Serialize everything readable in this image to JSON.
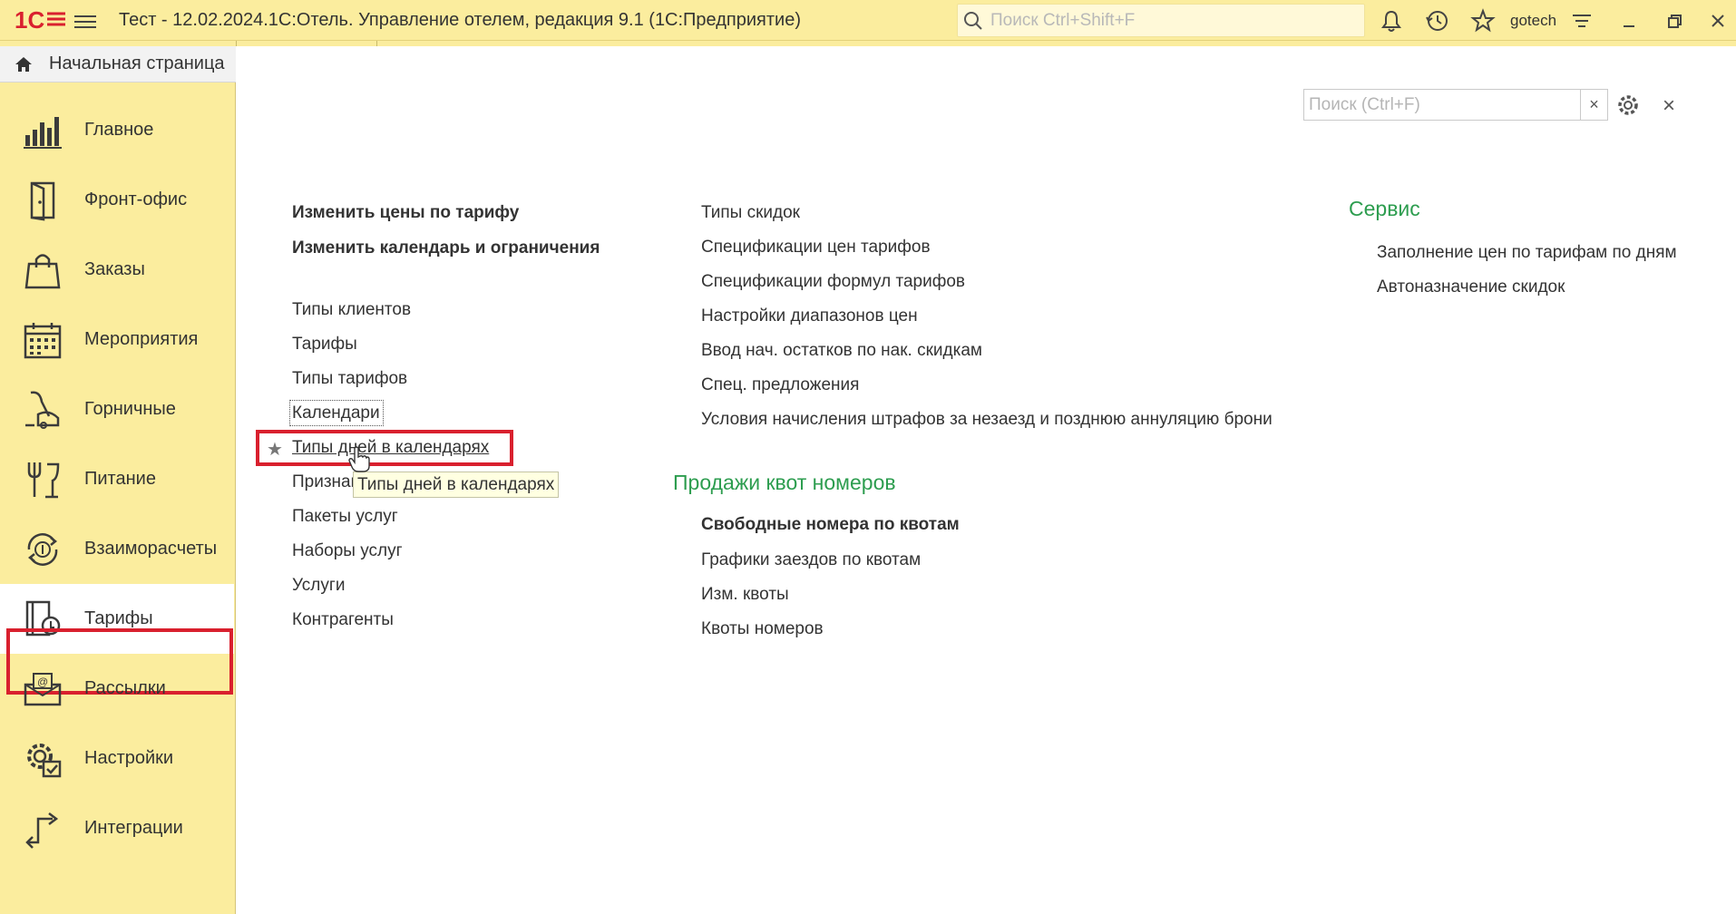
{
  "app": {
    "logo_text": "1С",
    "window_title": "Тест - 12.02.2024.1С:Отель. Управление отелем, редакция 9.1  (1С:Предприятие)",
    "search_placeholder": "Поиск Ctrl+Shift+F",
    "username": "gotech"
  },
  "sidebar": {
    "home_label": "Начальная страница",
    "items": [
      {
        "label": "Главное",
        "icon": "chart-bars-icon"
      },
      {
        "label": "Фронт-офис",
        "icon": "door-icon"
      },
      {
        "label": "Заказы",
        "icon": "shopping-bag-icon"
      },
      {
        "label": "Мероприятия",
        "icon": "calendar-icon"
      },
      {
        "label": "Горничные",
        "icon": "vacuum-cleaner-icon"
      },
      {
        "label": "Питание",
        "icon": "cutlery-icon"
      },
      {
        "label": "Взаиморасчеты",
        "icon": "currency-cycle-icon"
      },
      {
        "label": "Тарифы",
        "icon": "tariff-book-icon"
      },
      {
        "label": "Рассылки",
        "icon": "mailing-envelope-icon"
      },
      {
        "label": "Настройки",
        "icon": "settings-gear-icon"
      },
      {
        "label": "Интеграции",
        "icon": "integration-arrows-icon"
      }
    ],
    "active_item": "Тарифы"
  },
  "panel": {
    "search_placeholder": "Поиск (Ctrl+F)",
    "clear_label": "×",
    "close_label": "×"
  },
  "commands": {
    "col1_bold": [
      "Изменить цены по тарифу",
      "Изменить календарь и ограничения"
    ],
    "col1": [
      "Типы клиентов",
      "Тарифы",
      "Типы тарифов",
      "Календари",
      "Типы дней в календарях",
      "Признаки",
      "Пакеты услуг",
      "Наборы услуг",
      "Услуги",
      "Контрагенты"
    ],
    "col2": [
      "Типы скидок",
      "Спецификации цен тарифов",
      "Спецификации формул тарифов",
      "Настройки диапазонов цен",
      "Ввод нач. остатков по нак. скидкам",
      "Спец. предложения",
      "Условия начисления штрафов за незаезд и позднюю аннуляцию брони"
    ],
    "quota_group": "Продажи квот номеров",
    "quota_bold": "Свободные номера по квотам",
    "quota_items": [
      "Графики заездов по квотам",
      "Изм. квоты",
      "Квоты номеров"
    ],
    "service_group": "Сервис",
    "service_items": [
      "Заполнение цен по тарифам по дням",
      "Автоназначение скидок"
    ]
  },
  "tooltip": "Типы дней в календарях",
  "colors": {
    "panel_yellow": "#fbed9e",
    "group_green": "#2d9d4f",
    "highlight_red": "#d9202e",
    "logo_red": "#d9202e"
  }
}
